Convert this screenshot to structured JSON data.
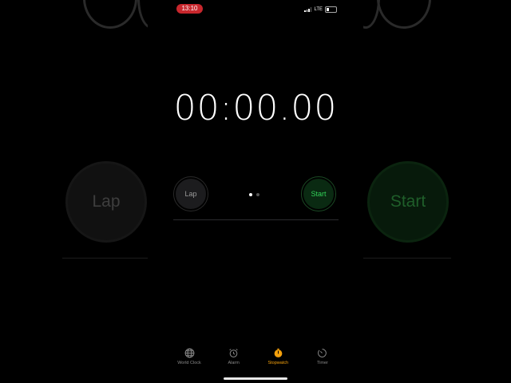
{
  "status_bar": {
    "time": "13:10",
    "network": "LTE"
  },
  "stopwatch": {
    "display": "00:00.00"
  },
  "controls": {
    "lap_label": "Lap",
    "start_label": "Start"
  },
  "page_dots": {
    "count": 2,
    "active": 0
  },
  "tabs": [
    {
      "label": "World Clock",
      "icon": "globe-icon",
      "active": false
    },
    {
      "label": "Alarm",
      "icon": "alarm-clock-icon",
      "active": false
    },
    {
      "label": "Stopwatch",
      "icon": "stopwatch-icon",
      "active": true
    },
    {
      "label": "Timer",
      "icon": "timer-icon",
      "active": false
    }
  ],
  "colors": {
    "accent": "#f5a10c",
    "start_green": "#32d158",
    "status_red": "#c8272d"
  }
}
